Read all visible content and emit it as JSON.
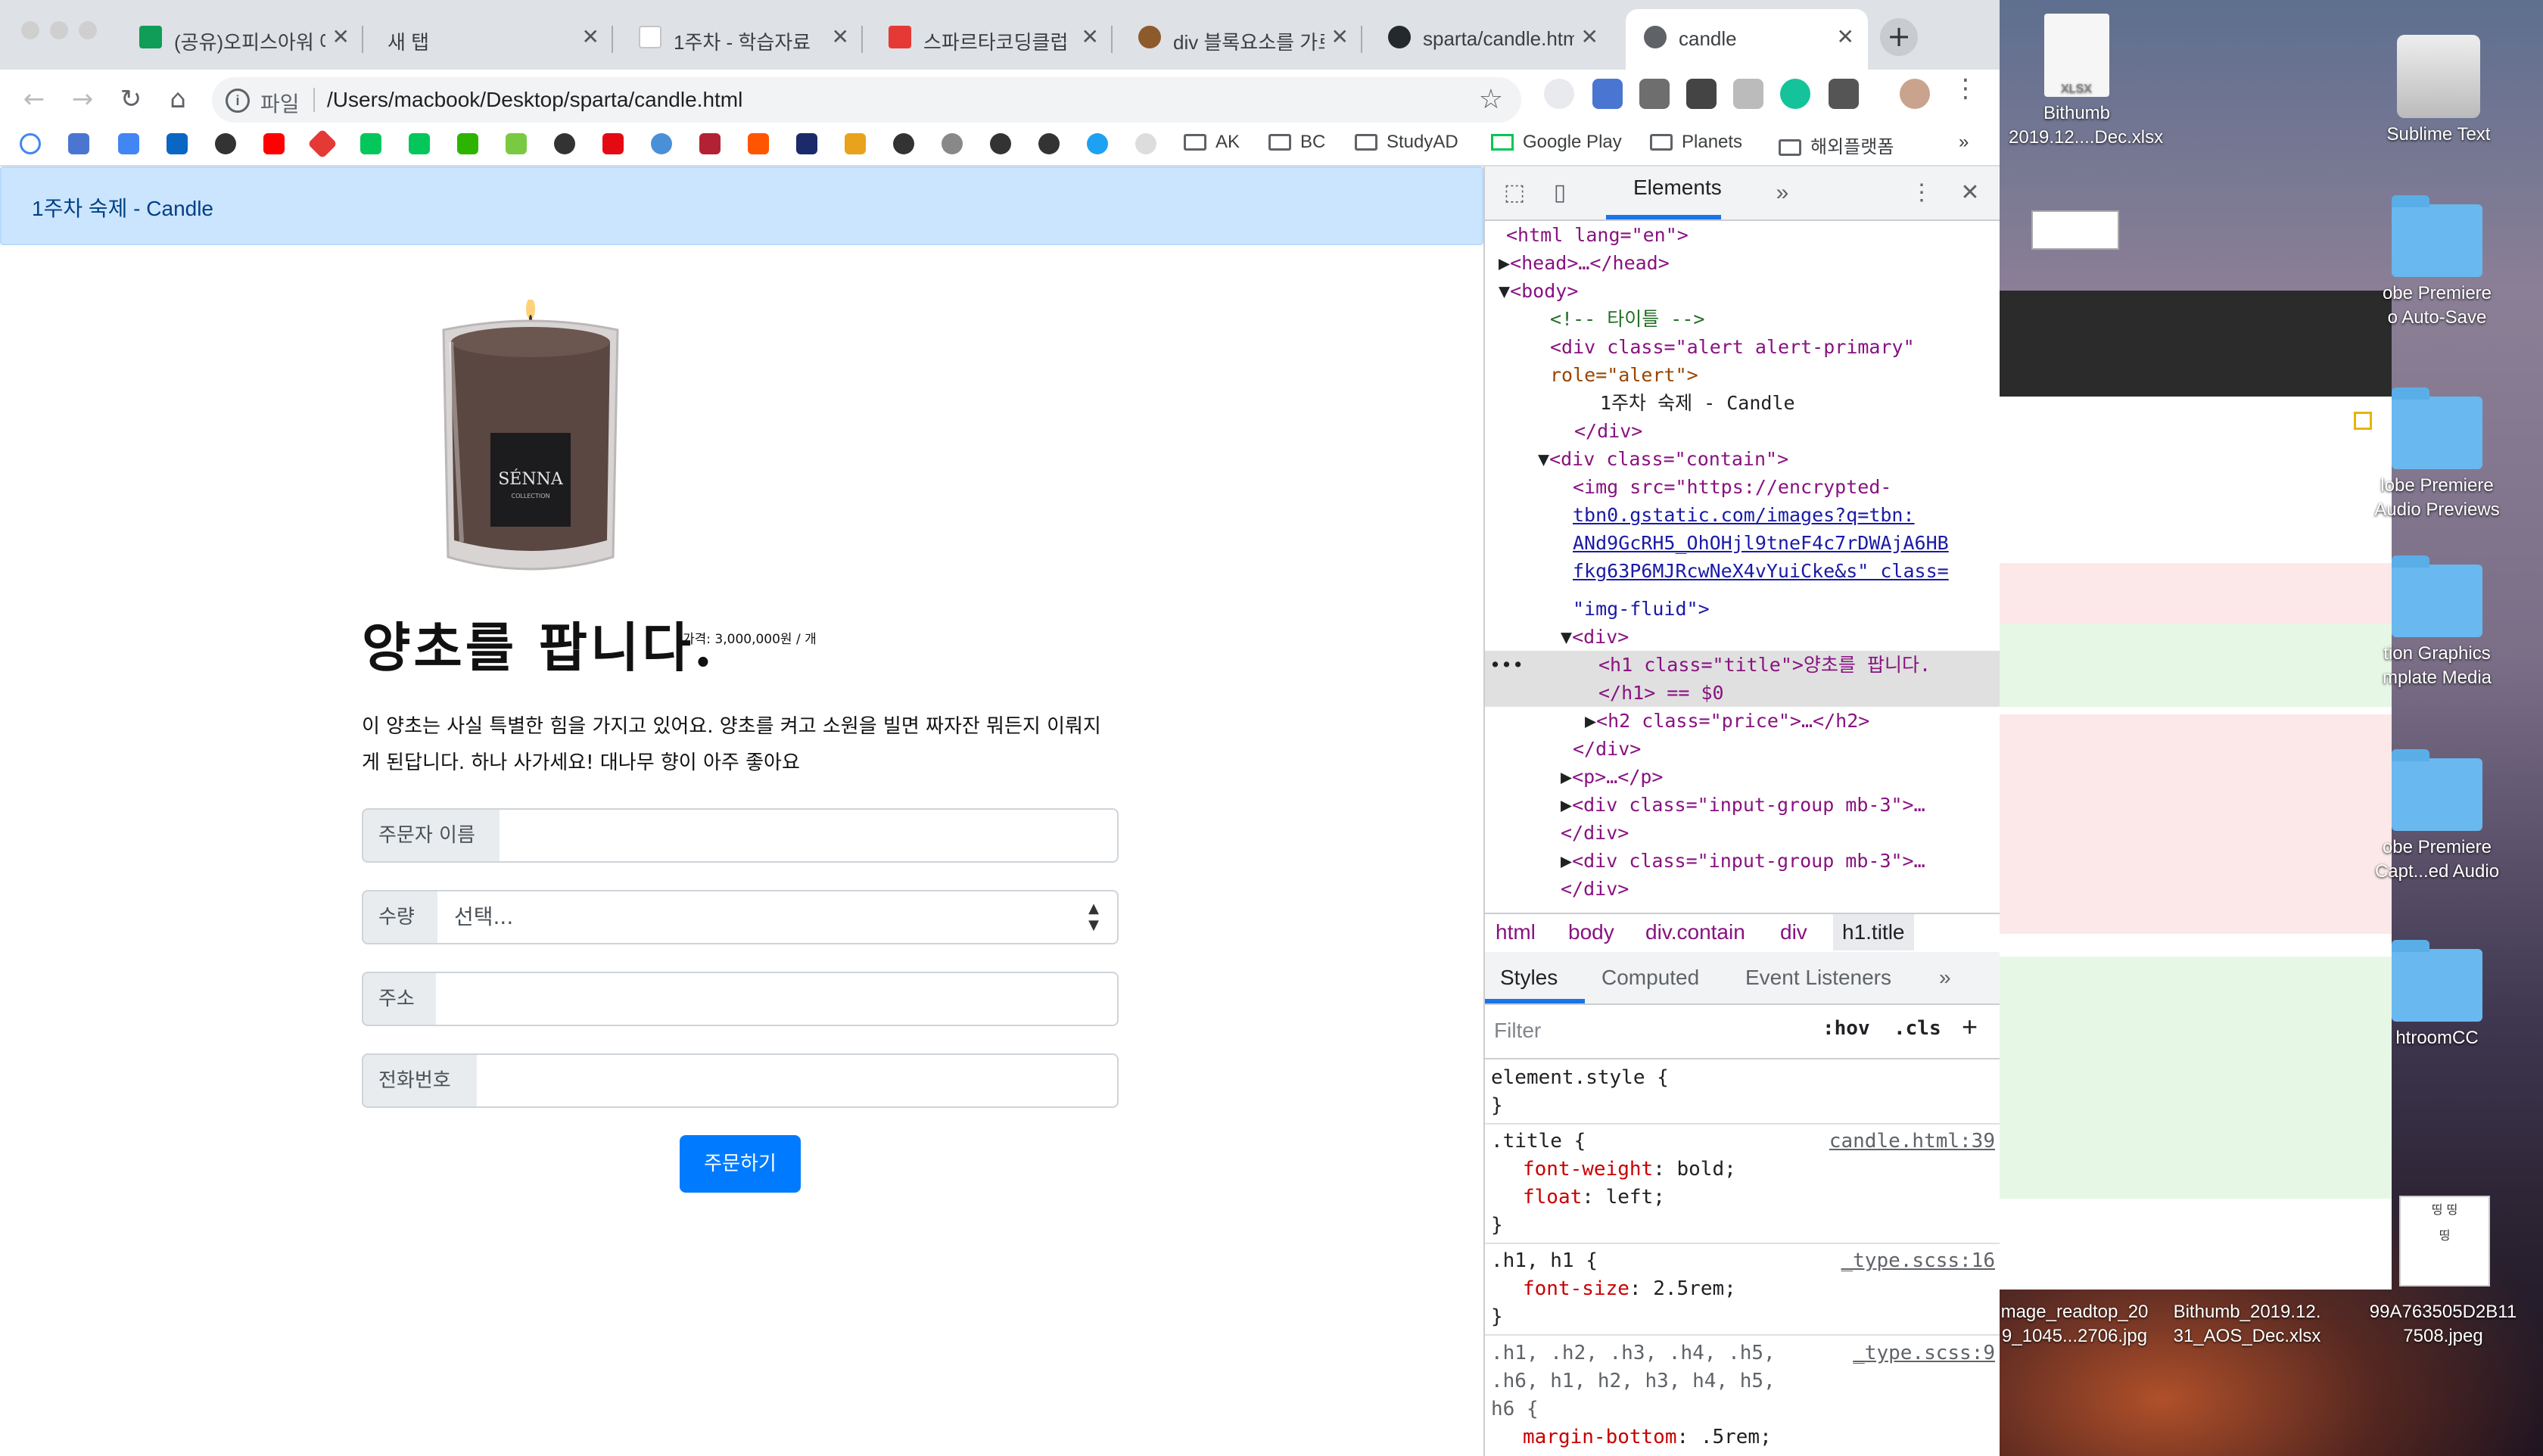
{
  "browser": {
    "tabs": [
      {
        "title": "(공유)오피스아워 예약",
        "icon_color": "#0f9d58"
      },
      {
        "title": "새 탭",
        "icon_color": ""
      },
      {
        "title": "1주차 - 학습자료",
        "icon_color": "#e4e4e4"
      },
      {
        "title": "스파르타코딩클럽 | 스",
        "icon_color": "#e53935"
      },
      {
        "title": "div 블록요소를 가로",
        "icon_color": "#8d5a2b"
      },
      {
        "title": "sparta/candle.html",
        "icon_color": "#24292e"
      },
      {
        "title": "candle",
        "icon_color": "#5f6368"
      }
    ],
    "address_label": "파일",
    "url": "/Users/macbook/Desktop/sparta/candle.html",
    "bookmarks": [
      "AK",
      "BC",
      "StudyAD",
      "Google Play",
      "Planets",
      "해외플랫폼"
    ],
    "bookmark_more": "»"
  },
  "page": {
    "alert_text": "1주차 숙제 - Candle",
    "title": "양초를 팝니다.",
    "price": "가격: 3,000,000원 / 개",
    "description": "이 양초는 사실 특별한 힘을 가지고 있어요. 양초를 켜고 소원을 빌면 짜자잔 뭐든지 이뤄지게 된답니다. 하나 사가세요! 대나무 향이 아주 좋아요",
    "candle_label": "SÉNNA",
    "candle_sub": "COLLECTION",
    "form": {
      "name_label": "주문자 이름",
      "qty_label": "수량",
      "qty_selected": "선택...",
      "address_label": "주소",
      "phone_label": "전화번호",
      "submit": "주문하기"
    }
  },
  "devtools": {
    "tab_elements": "Elements",
    "more": "»",
    "dom": [
      {
        "indent": 0,
        "html": "<span class='tg'>&lt;html</span> <span class='an'>lang</span>=<span class='av'>\"en\"</span><span class='tg'>&gt;</span>"
      },
      {
        "indent": 1,
        "html": "▶<span class='tg'>&lt;head&gt;</span>…<span class='tg'>&lt;/head&gt;</span>"
      },
      {
        "indent": 1,
        "html": "▼<span class='tg'>&lt;body&gt;</span>"
      }
    ],
    "dom_lines": {
      "l1": "<html lang=\"en\">",
      "l2": "<head>…</head>",
      "l3": "<body>",
      "l4": "<!-- 타이틀 -->",
      "l5": "<div class=\"alert alert-primary\"",
      "l6": "role=\"alert\">",
      "l7": "1주차 숙제 - Candle",
      "l8": "</div>",
      "l9": "<div class=\"contain\">",
      "l10": "<img src=\"https://encrypted-",
      "l11": "tbn0.gstatic.com/images?q=tbn:",
      "l12": "ANd9GcRH5_OhOHjl9tneF4c7rDWAjA6HB",
      "l13": "fkg63P6MJRcwNeX4vYuiCke&s\" class=",
      "l14": "\"img-fluid\">",
      "l15": "<div>",
      "l16": "<h1 class=\"title\">양초를 팝니다.",
      "l17": "</h1> == $0",
      "l18": "<h2 class=\"price\">…</h2>",
      "l19": "</div>",
      "l20": "<p>…</p>",
      "l21": "<div class=\"input-group mb-3\">…",
      "l22": "</div>",
      "l23": "<div class=\"input-group mb-3\">…",
      "l24": "</div>"
    },
    "breadcrumbs": [
      "html",
      "body",
      "div.contain",
      "div",
      "h1.title"
    ],
    "style_tabs": [
      "Styles",
      "Computed",
      "Event Listeners",
      "»"
    ],
    "filter_placeholder": "Filter",
    "hov": ":hov",
    "cls": ".cls",
    "styles": {
      "s1": "element.style {",
      "s2": "}",
      "s3": ".title {",
      "s3src": "candle.html:39",
      "s4p": "font-weight",
      "s4v": "bold;",
      "s5p": "float",
      "s5v": "left;",
      "s6": "}",
      "s7": ".h1, h1 {",
      "s7src": "_type.scss:16",
      "s8p": "font-size",
      "s8v": "2.5rem;",
      "s9": "}",
      "s10": ".h1, .h2, .h3, .h4, .h5,",
      "s10src": "_type.scss:9",
      "s11": ".h6, h1, h2, h3, h4, h5,",
      "s12": "h6 {",
      "s13p": "margin-bottom",
      "s13v": ".5rem;"
    }
  },
  "desktop": {
    "items": [
      {
        "label": "Bithumb\n2019.12....Dec.xlsx"
      },
      {
        "label": "Sublime Text"
      },
      {
        "label": "obe Premiere\no Auto-Save"
      },
      {
        "label": "lobe Premiere\nAudio Previews"
      },
      {
        "label": "tion Graphics\nmplate Media"
      },
      {
        "label": "obe Premiere\nCapt...ed Audio"
      },
      {
        "label": "htroomCC"
      },
      {
        "label": "mage_readtop_20\n9_1045...2706.jpg"
      },
      {
        "label": "Bithumb_2019.12.\n31_AOS_Dec.xlsx"
      },
      {
        "label": "99A763505D2B11\n7508.jpeg"
      }
    ],
    "thumb_text": "띵 띵\n띵"
  }
}
